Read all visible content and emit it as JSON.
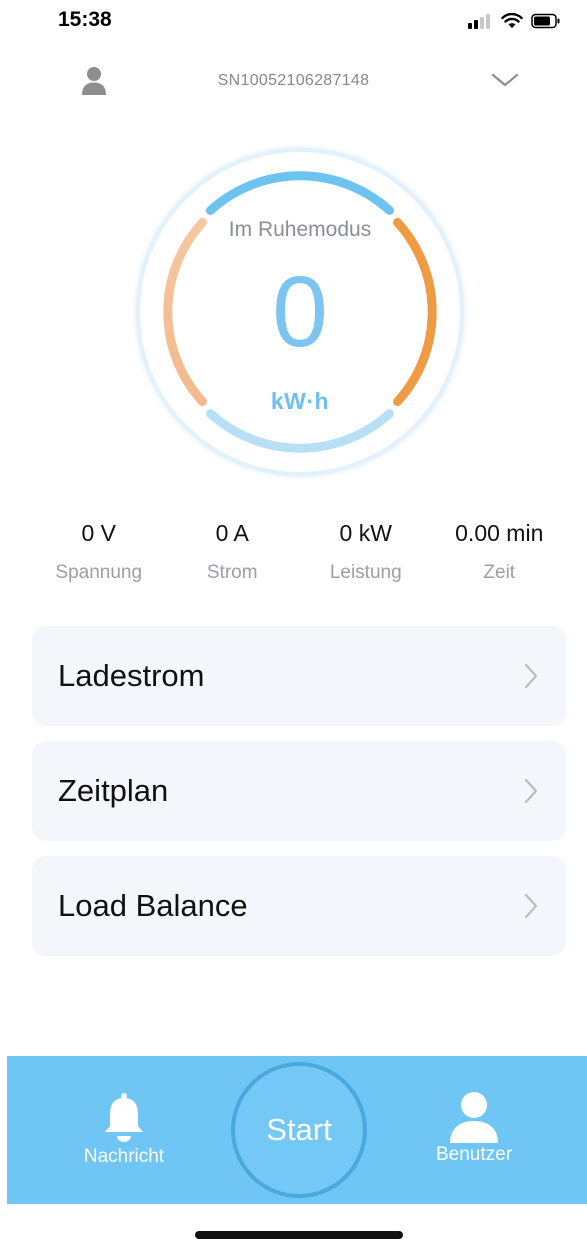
{
  "status_bar": {
    "time": "15:38",
    "icons": [
      "signal-icon",
      "wifi-icon",
      "battery-icon"
    ]
  },
  "header": {
    "serial": "SN10052106287148",
    "user_icon": "user-icon",
    "dropdown_icon": "chevron-down-icon"
  },
  "gauge": {
    "status": "Im Ruhemodus",
    "value": "0",
    "unit": "kW·h"
  },
  "stats": [
    {
      "value": "0 V",
      "label": "Spannung"
    },
    {
      "value": "0 A",
      "label": "Strom"
    },
    {
      "value": "0 kW",
      "label": "Leistung"
    },
    {
      "value": "0.00 min",
      "label": "Zeit"
    }
  ],
  "menu": [
    {
      "label": "Ladestrom"
    },
    {
      "label": "Zeitplan"
    },
    {
      "label": "Load Balance"
    }
  ],
  "tabbar": {
    "notifications_label": "Nachricht",
    "start_label": "Start",
    "user_label": "Benutzer"
  },
  "colors": {
    "accent": "#6fc6f4",
    "gauge_blue": "#7cc4f1",
    "gauge_orange": "#f0a04a",
    "card_bg": "#f3f7fb"
  }
}
